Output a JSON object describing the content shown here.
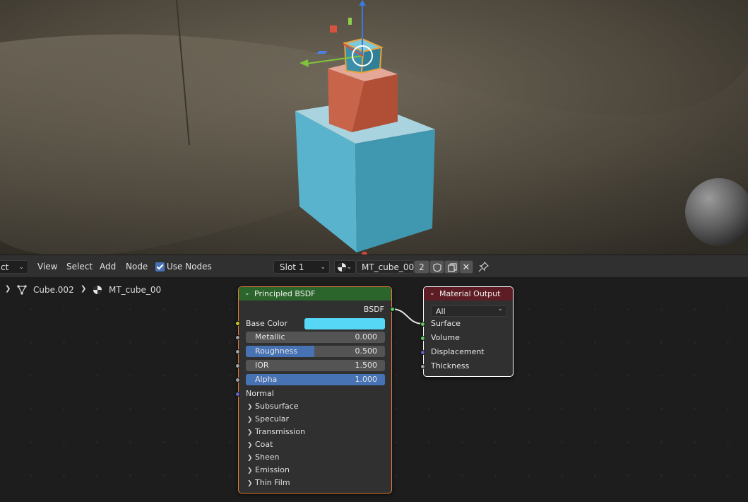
{
  "header": {
    "mode_label": "ct",
    "menu": [
      "View",
      "Select",
      "Add",
      "Node"
    ],
    "use_nodes_label": "Use Nodes",
    "use_nodes_checked": true,
    "slot_label": "Slot 1",
    "material_name": "MT_cube_00",
    "user_count": "2"
  },
  "breadcrumb": {
    "object": "Cube.002",
    "material": "MT_cube_00"
  },
  "principled": {
    "title": "Principled BSDF",
    "output": "BSDF",
    "base_color_label": "Base Color",
    "base_color_value": "#56d7f5",
    "fields": [
      {
        "name": "Metallic",
        "value": "0.000",
        "fraction": 0.0
      },
      {
        "name": "Roughness",
        "value": "0.500",
        "fraction": 0.5
      },
      {
        "name": "IOR",
        "value": "1.500",
        "fraction": 0.0
      },
      {
        "name": "Alpha",
        "value": "1.000",
        "fraction": 1.0
      }
    ],
    "normal_label": "Normal",
    "panels": [
      "Subsurface",
      "Specular",
      "Transmission",
      "Coat",
      "Sheen",
      "Emission",
      "Thin Film"
    ]
  },
  "material_output": {
    "title": "Material Output",
    "target": "All",
    "inputs": [
      "Surface",
      "Volume",
      "Displacement",
      "Thickness"
    ]
  },
  "colors": {
    "shader_header": "#2b652b",
    "output_header": "#5e1d24",
    "selected_outline": "#e17b3a",
    "active_outline": "#ffffff",
    "accent": "#4772b3"
  }
}
